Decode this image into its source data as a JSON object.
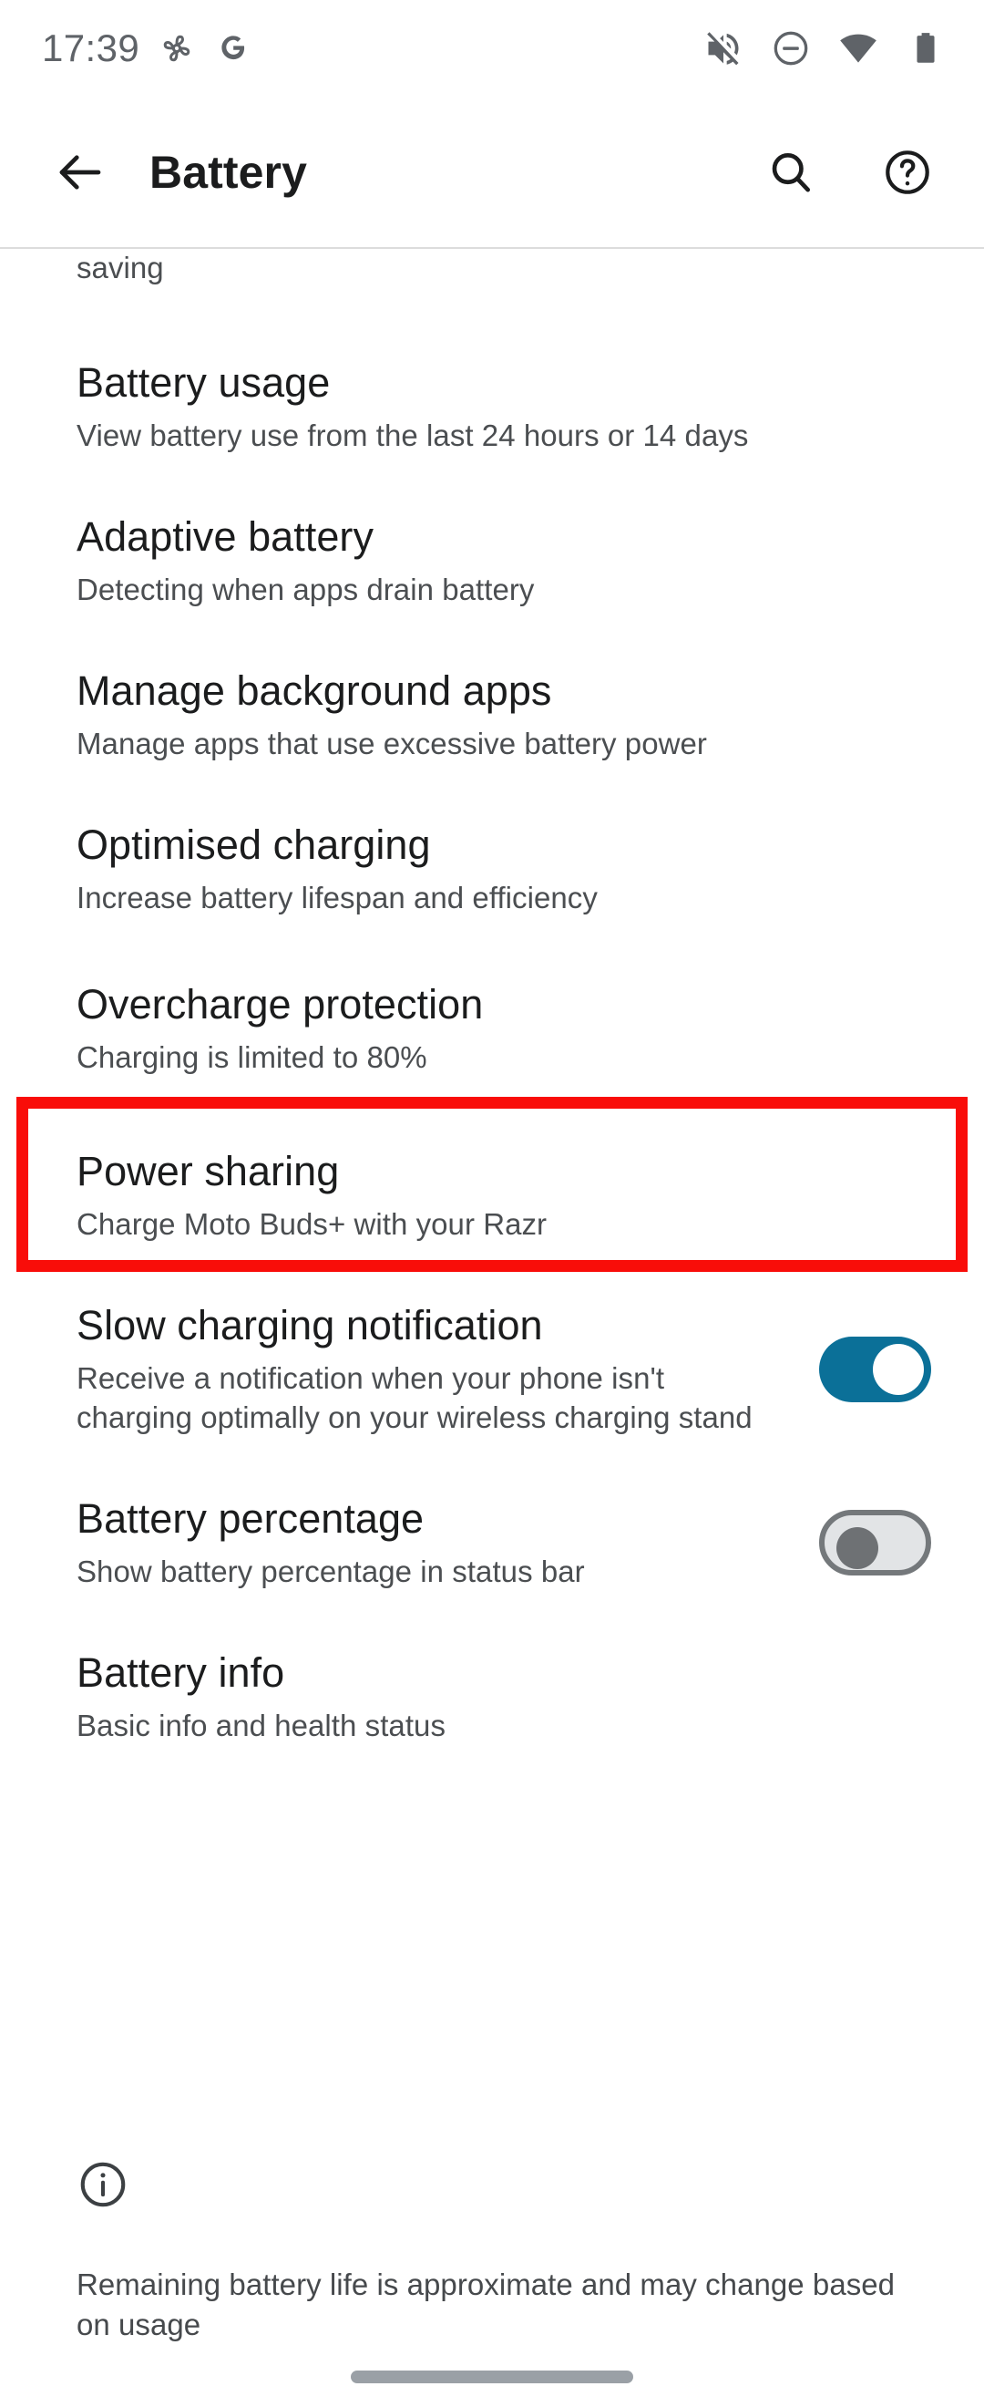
{
  "status_bar": {
    "clock": "17:39",
    "left_icons": [
      "pinwheel-icon",
      "google-g-icon"
    ],
    "right_icons": [
      "volume-off-icon",
      "do-not-disturb-icon",
      "wifi-icon",
      "battery-full-icon"
    ],
    "icon_color": "#5f6368"
  },
  "app_bar": {
    "back_label": "back-arrow",
    "title": "Battery",
    "search_label": "search",
    "help_label": "help"
  },
  "highlight": {
    "color": "#f90d09",
    "target": "Overcharge protection"
  },
  "list": {
    "clipped_top": {
      "sub": "saving"
    },
    "items": [
      {
        "title": "Battery usage",
        "sub": "View battery use from the last 24 hours or 14 days",
        "type": "nav"
      },
      {
        "title": "Adaptive battery",
        "sub": "Detecting when apps drain battery",
        "type": "nav"
      },
      {
        "title": "Manage background apps",
        "sub": "Manage apps that use excessive battery power",
        "type": "nav"
      },
      {
        "title": "Optimised charging",
        "sub": "Increase battery lifespan and efficiency",
        "type": "nav"
      },
      {
        "title": "Overcharge protection",
        "sub": "Charging is limited to 80%",
        "type": "nav",
        "highlighted": true
      },
      {
        "title": "Power sharing",
        "sub": "Charge Moto Buds+ with your Razr",
        "type": "nav"
      },
      {
        "title": "Slow charging notification",
        "sub": "Receive a notification when your phone isn't charging optimally on your wireless charging stand",
        "type": "toggle",
        "toggle_state": "on"
      },
      {
        "title": "Battery percentage",
        "sub": "Show battery percentage in status bar",
        "type": "toggle",
        "toggle_state": "off"
      },
      {
        "title": "Battery info",
        "sub": "Basic info and health status",
        "type": "nav"
      }
    ]
  },
  "footer": {
    "icon": "info-icon",
    "note": "Remaining battery life is approximate and may change based on usage"
  },
  "colors": {
    "toggle_on": "#0b7098",
    "toggle_off_track": "#e2e4e6",
    "toggle_off_outline": "#74787b",
    "highlight": "#f90d09",
    "title_text": "#1b1c1d",
    "sub_text": "#4b4e51"
  },
  "nav": {
    "home_bar": "home-gesture-bar"
  }
}
